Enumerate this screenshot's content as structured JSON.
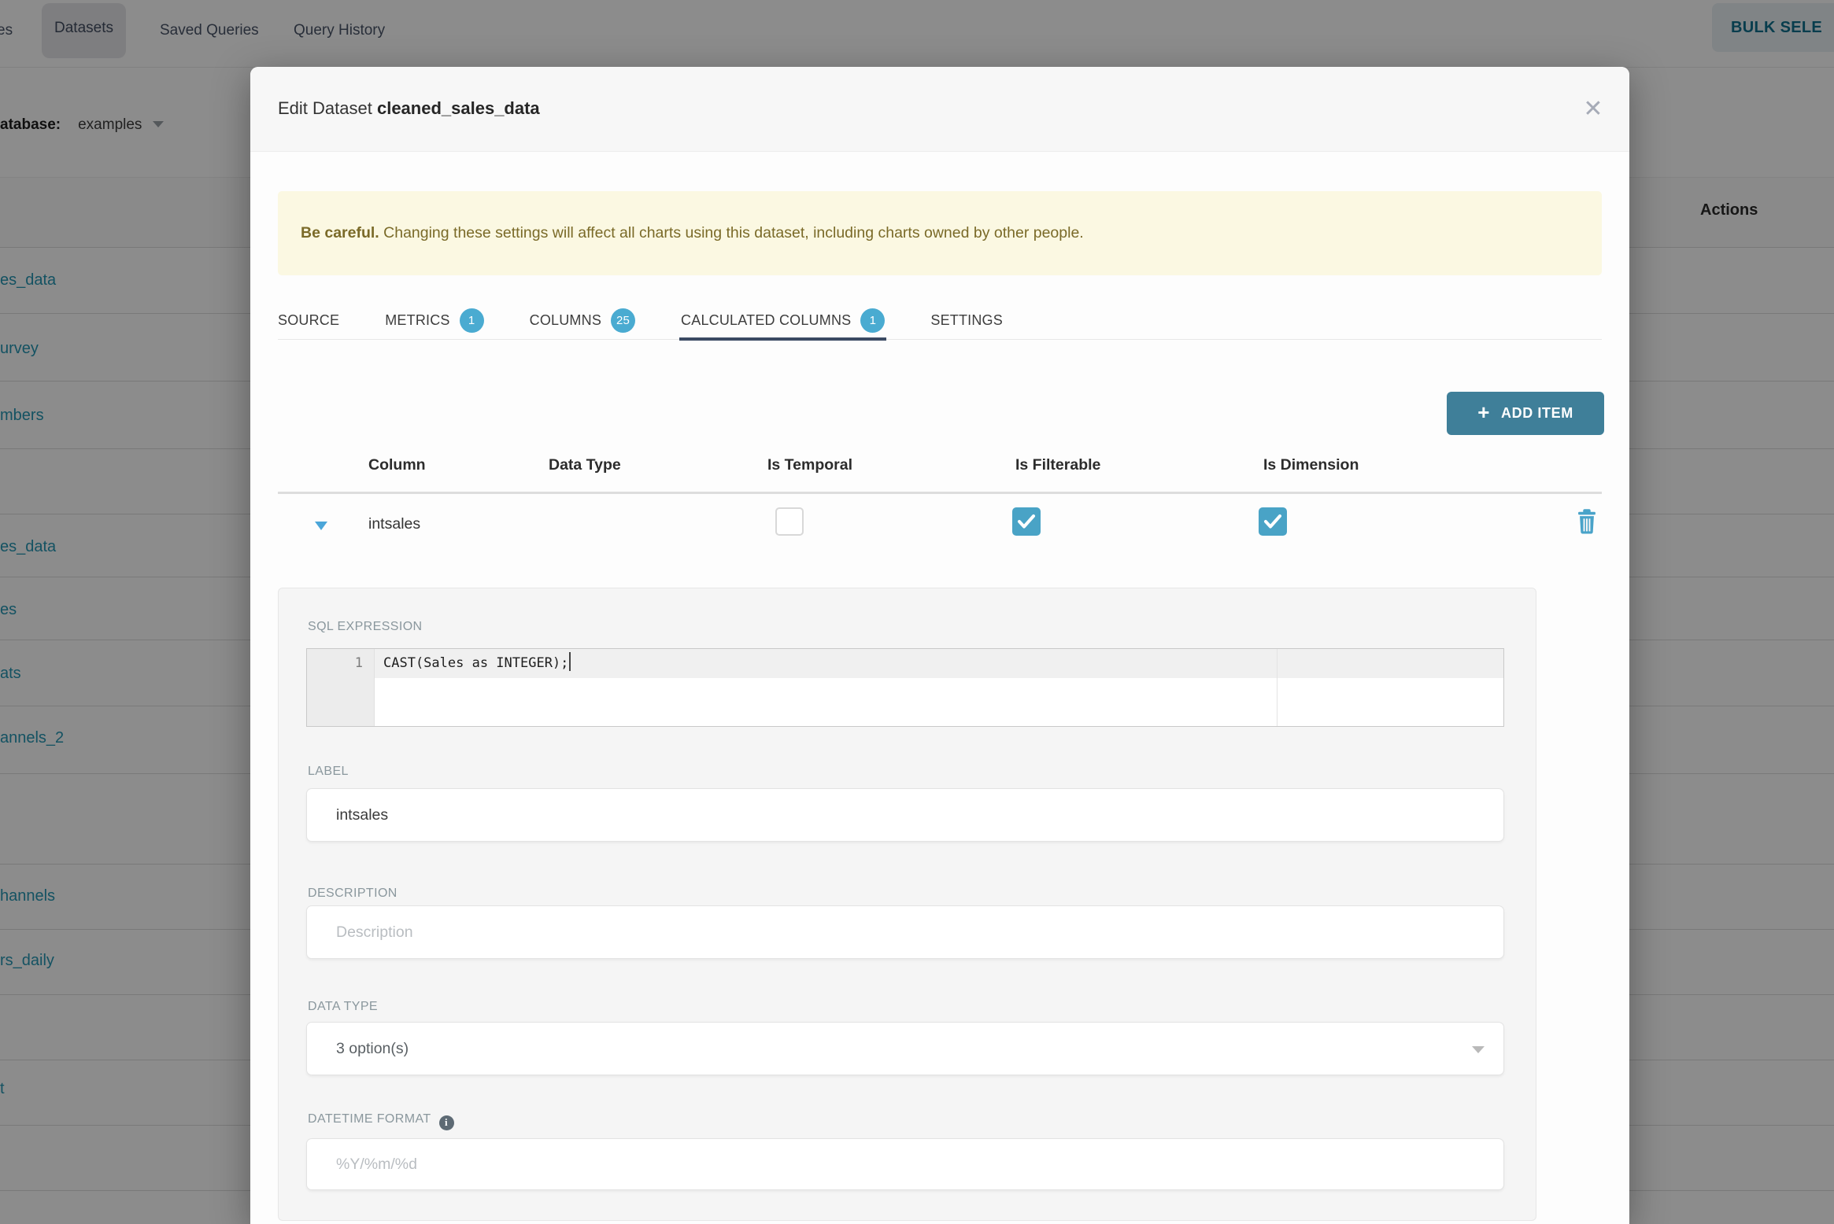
{
  "nav": {
    "fragment": "es",
    "active_tab": "Datasets",
    "items": [
      "Datasets",
      "Saved Queries",
      "Query History"
    ],
    "bulk_button": "BULK SELE"
  },
  "list_page": {
    "database_label": "atabase:",
    "database_value": "examples",
    "actions_header": "Actions",
    "dataset_links": [
      "es_data",
      "urvey",
      "mbers",
      "es_data",
      "es",
      "ats",
      "annels_2",
      "hannels",
      "rs_daily",
      "t"
    ]
  },
  "modal": {
    "title_prefix": "Edit Dataset",
    "title_name": "cleaned_sales_data",
    "close_glyph": "✕",
    "warning_bold": "Be careful.",
    "warning_text": " Changing these settings will affect all charts using this dataset, including charts owned by other people.",
    "tabs": [
      {
        "label": "SOURCE"
      },
      {
        "label": "METRICS",
        "badge": "1"
      },
      {
        "label": "COLUMNS",
        "badge": "25"
      },
      {
        "label": "CALCULATED COLUMNS",
        "badge": "1",
        "active": true
      },
      {
        "label": "SETTINGS"
      }
    ],
    "add_item_label": "ADD ITEM",
    "grid": {
      "headers": [
        "Column",
        "Data Type",
        "Is Temporal",
        "Is Filterable",
        "Is Dimension"
      ],
      "row": {
        "column": "intsales",
        "is_temporal": false,
        "is_filterable": true,
        "is_dimension": true
      }
    },
    "detail": {
      "sql_label": "SQL EXPRESSION",
      "sql_line_number": "1",
      "sql_code": "CAST(Sales as INTEGER);",
      "label_label": "LABEL",
      "label_value": "intsales",
      "description_label": "DESCRIPTION",
      "description_placeholder": "Description",
      "datatype_label": "DATA TYPE",
      "datatype_value": "3 option(s)",
      "datetime_label": "DATETIME FORMAT",
      "datetime_placeholder": "%Y/%m/%d"
    },
    "colors": {
      "accent": "#49a3c6",
      "badge": "#4aabd1",
      "add_button": "#3f7f99",
      "tab_underline": "#3b4a63",
      "warning_bg": "#fbf8e2",
      "warning_text": "#7a6a28",
      "link": "#2596b3"
    }
  }
}
